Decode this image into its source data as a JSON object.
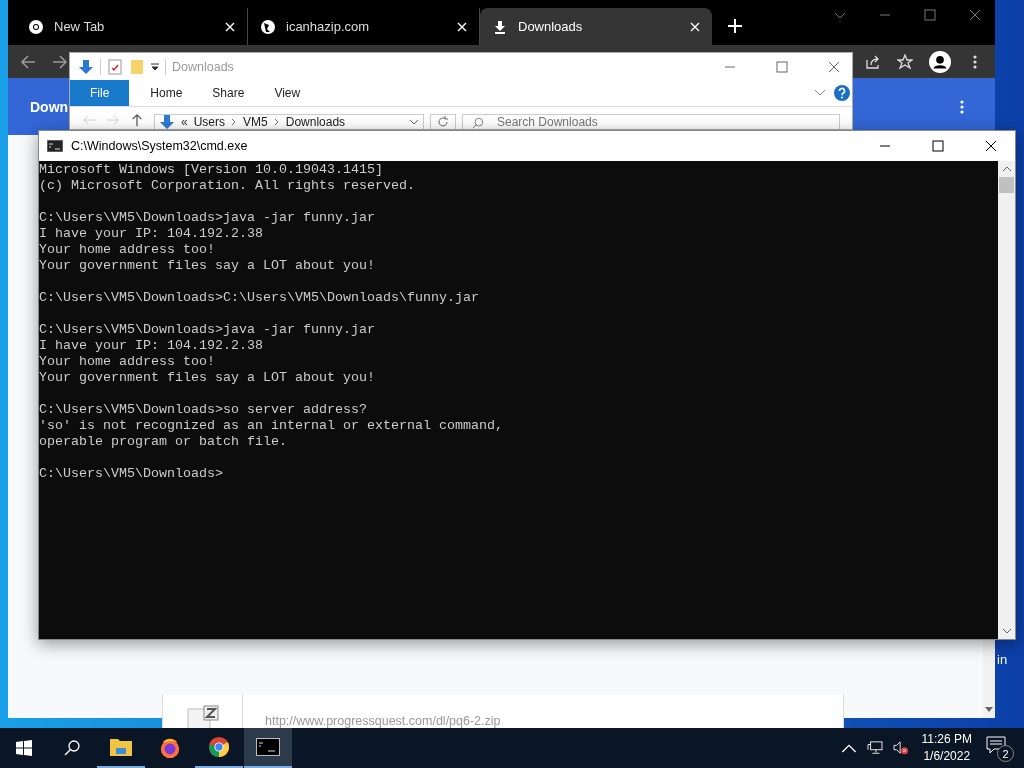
{
  "desktop": {
    "icon_label": "in"
  },
  "browser": {
    "tabs": [
      {
        "title": "New Tab",
        "selected": false
      },
      {
        "title": "icanhazip.com",
        "selected": false
      },
      {
        "title": "Downloads",
        "selected": true
      }
    ],
    "header_title": "Down",
    "download": {
      "url": "http://www.progressquest.com/dl/pq6-2.zip"
    }
  },
  "explorer": {
    "title": "Downloads",
    "ribbon_tabs": [
      {
        "label": "File",
        "selected": true
      },
      {
        "label": "Home",
        "selected": false
      },
      {
        "label": "Share",
        "selected": false
      },
      {
        "label": "View",
        "selected": false
      }
    ],
    "address_prefix": "«",
    "address": [
      "Users",
      "VM5",
      "Downloads"
    ],
    "search": {
      "placeholder": "Search Downloads"
    }
  },
  "terminal": {
    "title": "C:\\Windows\\System32\\cmd.exe",
    "blocks": [
      [
        "Microsoft Windows [Version 10.0.19043.1415]",
        "(c) Microsoft Corporation. All rights reserved."
      ],
      [
        "C:\\Users\\VM5\\Downloads>java -jar funny.jar",
        "I have your IP: 104.192.2.38",
        "Your home address too!",
        "Your government files say a LOT about you!"
      ],
      [
        "C:\\Users\\VM5\\Downloads>C:\\Users\\VM5\\Downloads\\funny.jar"
      ],
      [
        "C:\\Users\\VM5\\Downloads>java -jar funny.jar",
        "I have your IP: 104.192.2.38",
        "Your home address too!",
        "Your government files say a LOT about you!"
      ],
      [
        "C:\\Users\\VM5\\Downloads>so server address?",
        "'so' is not recognized as an internal or external command,",
        "operable program or batch file."
      ],
      [
        "C:\\Users\\VM5\\Downloads>"
      ]
    ]
  },
  "taskbar": {
    "apps": [
      {
        "kind": "explorer",
        "running": true,
        "selected": false
      },
      {
        "kind": "firefox",
        "running": false,
        "selected": false
      },
      {
        "kind": "chrome",
        "running": true,
        "selected": false
      },
      {
        "kind": "terminal",
        "running": true,
        "selected": true
      }
    ],
    "time": "11:26 PM",
    "date": "1/6/2022",
    "notifications": "2"
  }
}
